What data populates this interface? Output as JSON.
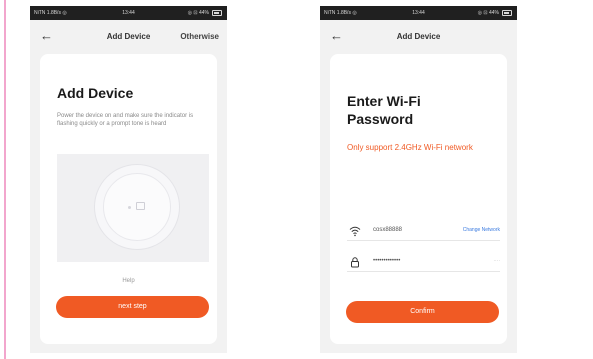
{
  "left_screen": {
    "status": {
      "left": "NiTN 1.8B/s ◎",
      "center": "13:44",
      "right": "◎ ⊡ 44% "
    },
    "nav": {
      "back_icon": "arrow-left-icon",
      "title": "Add Device",
      "action": "Otherwise"
    },
    "heading": "Add Device",
    "description": "Power the device on and make sure the indicator is flashing quickly or a prompt tone is heard",
    "illustration_icon": "device-reset-illustration",
    "help": "Help",
    "next_button": "next step"
  },
  "right_screen": {
    "status": {
      "left": "NiTN 1.8B/s ◎",
      "center": "13:44",
      "right": "◎ ⊡ 44% "
    },
    "nav": {
      "back_icon": "arrow-left-icon",
      "title": "Add Device"
    },
    "heading_line1": "Enter Wi-Fi",
    "heading_line2": "Password",
    "warning": "Only support 2.4GHz Wi-Fi network",
    "wifi": {
      "icon": "wifi-icon",
      "ssid": "cosx88888",
      "change_label": "Change Network"
    },
    "password": {
      "icon": "lock-icon",
      "value": "•••••••••••••",
      "toggle": "····"
    },
    "confirm_button": "Confirm"
  },
  "colors": {
    "accent": "#f05a24",
    "link": "#3b7be0",
    "background": "#f2f2f2",
    "card": "#ffffff"
  }
}
